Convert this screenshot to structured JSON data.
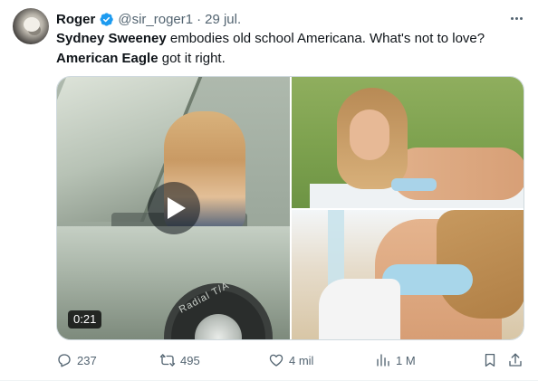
{
  "tweet": {
    "author_name": "Roger",
    "handle": "@sir_roger1",
    "separator": "·",
    "date": "29 jul.",
    "text": {
      "line1_bold": "Sydney Sweeney",
      "line1_rest": " embodies old school Americana. What's not to love?",
      "line2_bold": "American Eagle",
      "line2_rest": " got it right."
    },
    "media": {
      "video_duration": "0:21",
      "video_badge_text": "Radial T/A"
    },
    "actions": {
      "replies": "237",
      "reposts": "495",
      "likes": "4 mil",
      "views": "1 M"
    }
  },
  "icons": {
    "verified": "verified-badge-icon",
    "more": "more-dots-icon",
    "reply": "reply-icon",
    "repost": "repost-icon",
    "like": "heart-icon",
    "views": "views-chart-icon",
    "bookmark": "bookmark-icon",
    "share": "share-icon",
    "play": "play-icon"
  },
  "colors": {
    "verified_blue": "#1d9bf0",
    "text_primary": "#0f1419",
    "text_secondary": "#536471"
  }
}
